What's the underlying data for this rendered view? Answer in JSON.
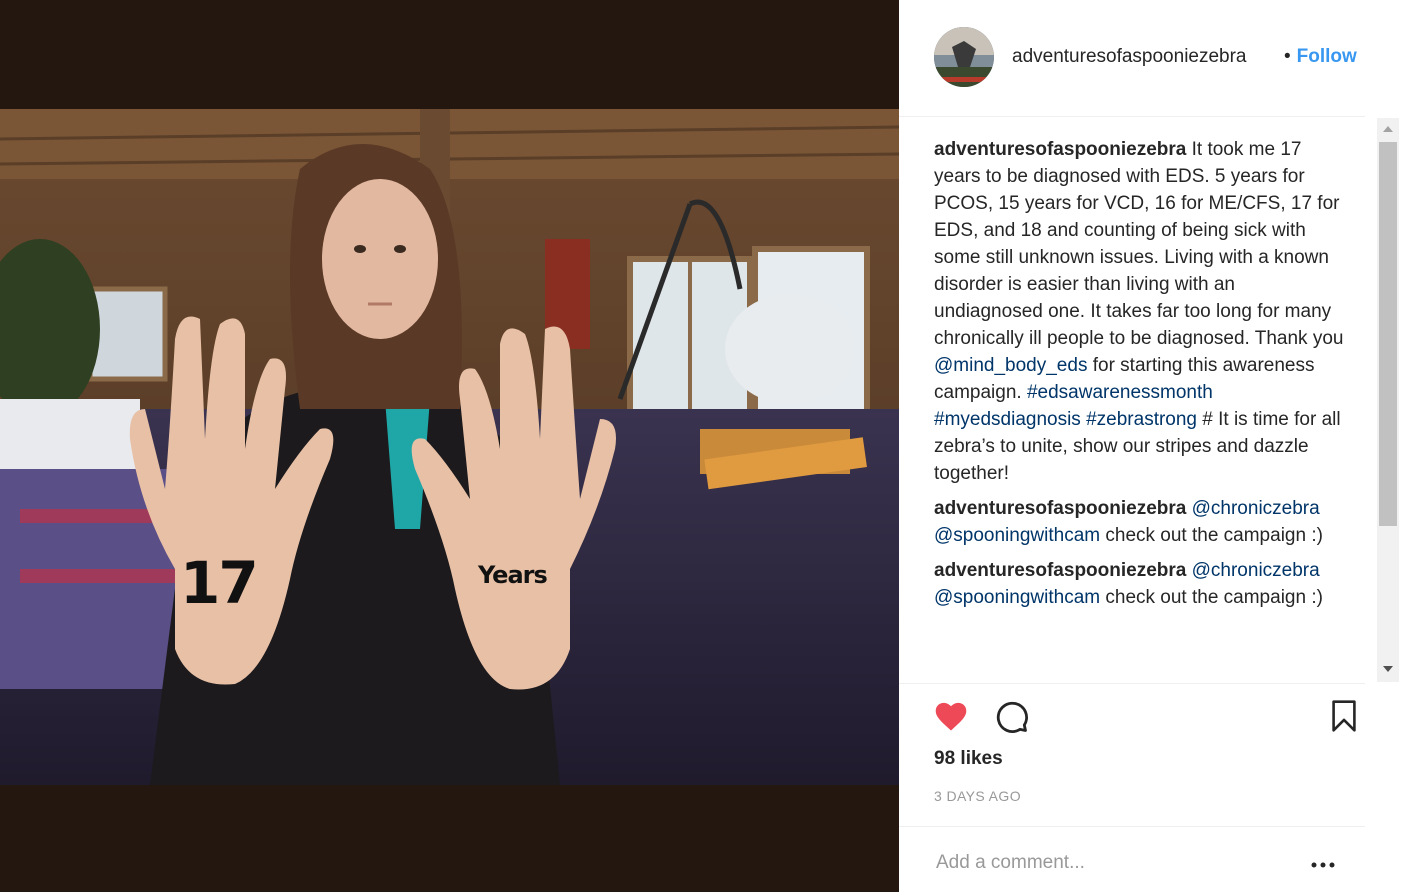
{
  "post": {
    "username": "adventuresofaspooniezebra",
    "follow_separator": "•",
    "follow_label": "Follow",
    "hand_left_text": "17",
    "hand_right_text": "Years"
  },
  "comments": [
    {
      "user": "adventuresofaspooniezebra",
      "text_parts": [
        {
          "t": " It took me 17 years to be diagnosed with EDS. 5 years for PCOS, 15 years for VCD, 16 for ME/CFS, 17 for EDS, and 18 and counting of being sick with some still unknown issues. Living with a known disorder is easier than living with an undiagnosed one. It takes far too long for many chronically ill people to be diagnosed. Thank you ",
          "link": false
        },
        {
          "t": "@mind_body_eds",
          "link": true
        },
        {
          "t": " for starting this awareness campaign. ",
          "link": false
        },
        {
          "t": "#edsawarenessmonth",
          "link": true
        },
        {
          "t": " ",
          "link": false
        },
        {
          "t": "#myedsdiagnosis",
          "link": true
        },
        {
          "t": " ",
          "link": false
        },
        {
          "t": "#zebrastrong",
          "link": true
        },
        {
          "t": " # It is time for all zebra’s to unite, show our stripes and dazzle together!",
          "link": false
        }
      ]
    },
    {
      "user": "adventuresofaspooniezebra",
      "text_parts": [
        {
          "t": " ",
          "link": false
        },
        {
          "t": "@chroniczebra",
          "link": true
        },
        {
          "t": " ",
          "link": false
        },
        {
          "t": "@spooningwithcam",
          "link": true
        },
        {
          "t": " check out the campaign :)",
          "link": false
        }
      ]
    },
    {
      "user": "adventuresofaspooniezebra",
      "text_parts": [
        {
          "t": " ",
          "link": false
        },
        {
          "t": "@chroniczebra",
          "link": true
        },
        {
          "t": " ",
          "link": false
        },
        {
          "t": "@spooningwithcam",
          "link": true
        },
        {
          "t": " check out the campaign :)",
          "link": false
        }
      ]
    }
  ],
  "actions": {
    "like_icon": "heart-icon",
    "comment_icon": "comment-icon",
    "save_icon": "bookmark-icon",
    "likes_text": "98 likes",
    "timestamp": "3 DAYS AGO"
  },
  "add_comment": {
    "placeholder": "Add a comment...",
    "more_icon": "more-options-icon"
  },
  "colors": {
    "link": "#003569",
    "follow": "#3897f0",
    "heart": "#ed4956",
    "muted": "#999999"
  }
}
